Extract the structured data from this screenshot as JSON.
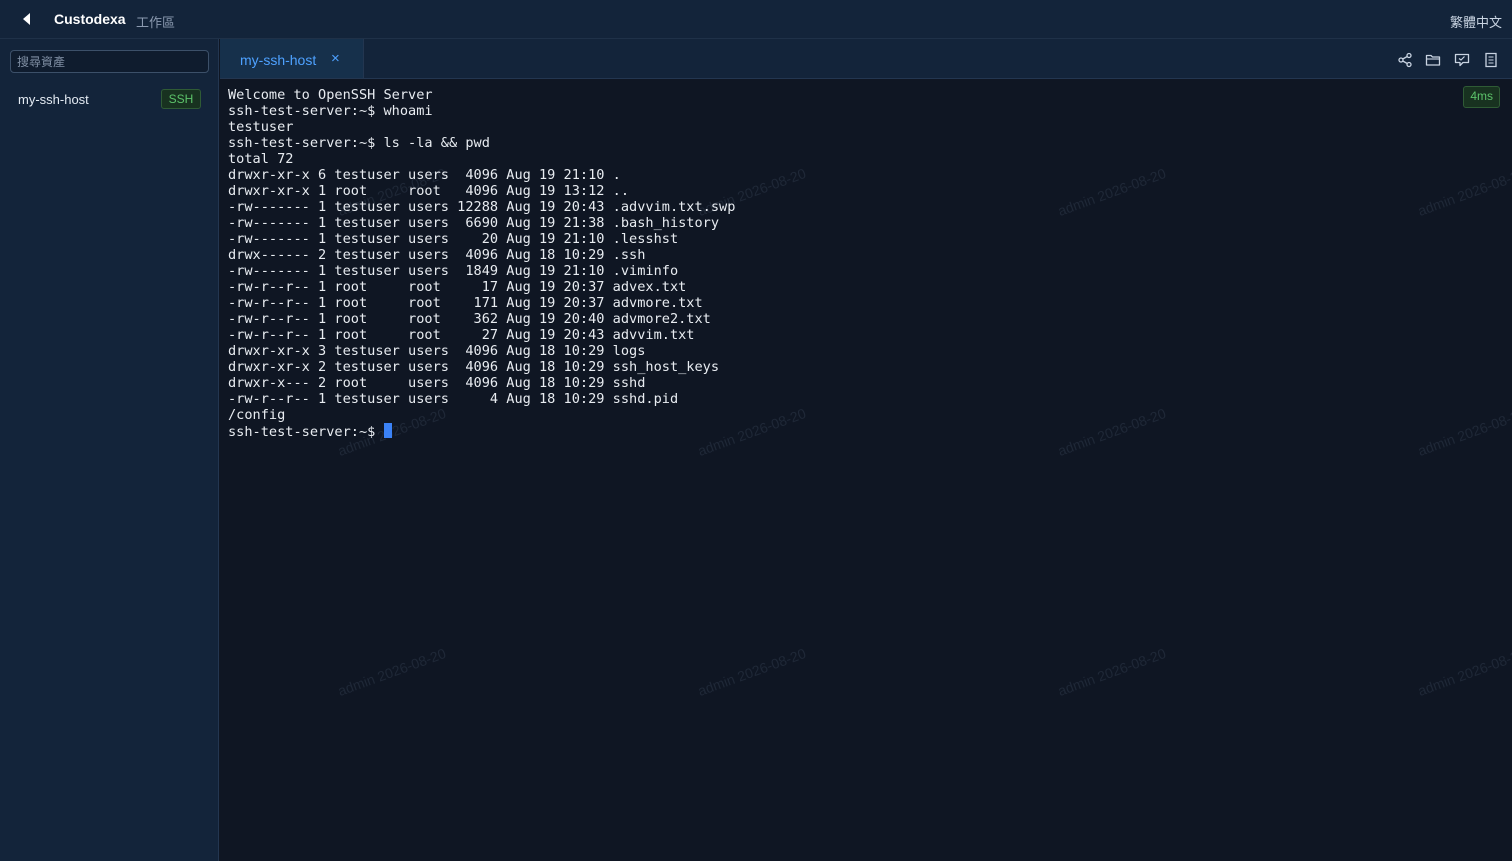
{
  "header": {
    "back_icon": "back-arrow-icon",
    "app_title": "Custodexa",
    "workspace": "工作區",
    "language": "繁體中文"
  },
  "sidebar": {
    "search_placeholder": "搜尋資產",
    "search_value": "",
    "assets": [
      {
        "name": "my-ssh-host",
        "protocol": "SSH"
      }
    ]
  },
  "tabs": [
    {
      "label": "my-ssh-host",
      "close": "×",
      "active": true
    }
  ],
  "toolbar": {
    "icons": [
      "share-icon",
      "folder-icon",
      "chat-icon",
      "document-icon"
    ]
  },
  "terminal": {
    "latency": "4ms",
    "watermark": "admin 2026-08-20",
    "lines": [
      "Welcome to OpenSSH Server",
      "ssh-test-server:~$ whoami",
      "testuser",
      "ssh-test-server:~$ ls -la && pwd",
      "total 72",
      "drwxr-xr-x 6 testuser users  4096 Aug 19 21:10 .",
      "drwxr-xr-x 1 root     root   4096 Aug 19 13:12 ..",
      "-rw------- 1 testuser users 12288 Aug 19 20:43 .advvim.txt.swp",
      "-rw------- 1 testuser users  6690 Aug 19 21:38 .bash_history",
      "-rw------- 1 testuser users    20 Aug 19 21:10 .lesshst",
      "drwx------ 2 testuser users  4096 Aug 18 10:29 .ssh",
      "-rw------- 1 testuser users  1849 Aug 19 21:10 .viminfo",
      "-rw-r--r-- 1 root     root     17 Aug 19 20:37 advex.txt",
      "-rw-r--r-- 1 root     root    171 Aug 19 20:37 advmore.txt",
      "-rw-r--r-- 1 root     root    362 Aug 19 20:40 advmore2.txt",
      "-rw-r--r-- 1 root     root     27 Aug 19 20:43 advvim.txt",
      "drwxr-xr-x 3 testuser users  4096 Aug 18 10:29 logs",
      "drwxr-xr-x 2 testuser users  4096 Aug 18 10:29 ssh_host_keys",
      "drwxr-x--- 2 root     users  4096 Aug 18 10:29 sshd",
      "-rw-r--r-- 1 testuser users     4 Aug 18 10:29 sshd.pid",
      "/config"
    ],
    "prompt": "ssh-test-server:~$ "
  },
  "colors": {
    "accent": "#4ea1ff",
    "cursor": "#3b82f6",
    "badge_green": "#5cc36a",
    "panel": "#13243a",
    "terminal_bg": "#0f1623"
  }
}
